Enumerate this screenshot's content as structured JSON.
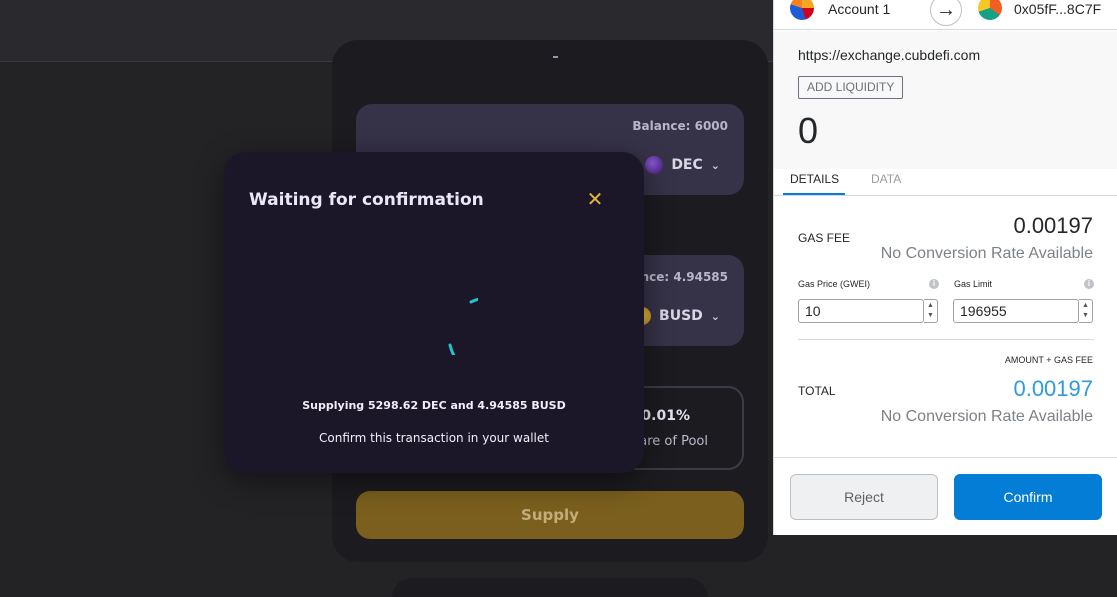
{
  "dapp": {
    "panel1": {
      "balance": "Balance: 6000",
      "token": "DEC"
    },
    "panel2": {
      "balance": "ance: 4.94585",
      "token": "BUSD"
    },
    "pool": {
      "share_pct": "<0.01%",
      "share_label": "are of Pool"
    },
    "supply_label": "Supply"
  },
  "modal": {
    "title": "Waiting for confirmation",
    "close_icon": "✕",
    "supplying_text": "Supplying 5298.62 DEC and 4.94585 BUSD",
    "confirm_hint": "Confirm this transaction in your wallet",
    "accent_color": "#e3b43a",
    "spinner_color": "#20c4d0"
  },
  "wallet": {
    "from_account": "Account 1",
    "to_address": "0x05fF...8C7F",
    "origin": "https://exchange.cubdefi.com",
    "action": "ADD LIQUIDITY",
    "amount": "0",
    "tabs": [
      "DETAILS",
      "DATA"
    ],
    "active_tab": "DETAILS",
    "gas_fee_label": "GAS FEE",
    "gas_fee_value": "0.00197",
    "no_conversion": "No Conversion Rate Available",
    "gas_price_label": "Gas Price (GWEI)",
    "gas_price_value": "10",
    "gas_limit_label": "Gas Limit",
    "gas_limit_value": "196955",
    "amount_plus_gas_label": "AMOUNT + GAS FEE",
    "total_label": "TOTAL",
    "total_value": "0.00197",
    "reject_label": "Reject",
    "confirm_label": "Confirm",
    "accent_color": "#037dd6"
  }
}
